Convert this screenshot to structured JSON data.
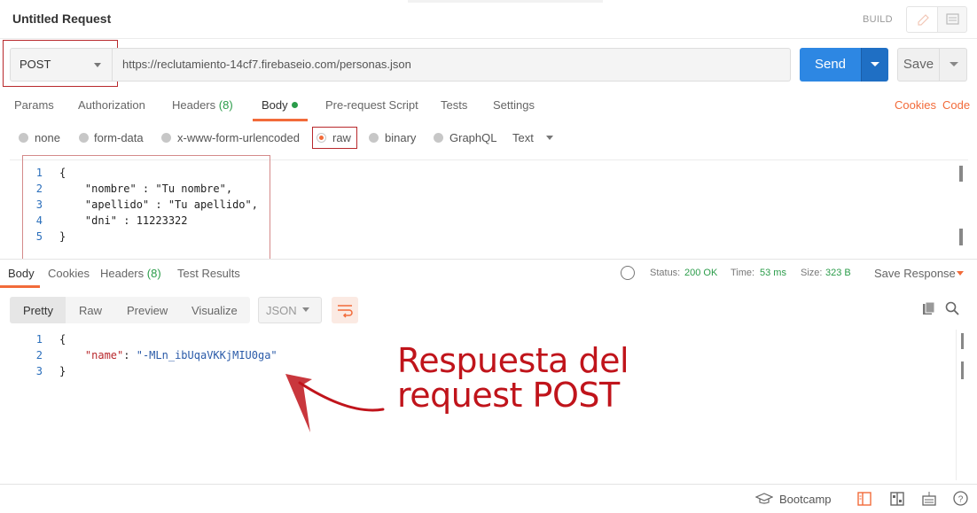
{
  "header": {
    "title": "Untitled Request",
    "build_label": "BUILD"
  },
  "request": {
    "method": "POST",
    "url": "https://reclutamiento-14cf7.firebaseio.com/personas.json",
    "send_label": "Send",
    "save_label": "Save"
  },
  "request_tabs": {
    "params": "Params",
    "authorization": "Authorization",
    "headers": "Headers",
    "headers_count": "(8)",
    "body": "Body",
    "prescript": "Pre-request Script",
    "tests": "Tests",
    "settings": "Settings",
    "cookies": "Cookies",
    "code": "Code"
  },
  "body_types": {
    "none": "none",
    "form_data": "form-data",
    "urlencoded": "x-www-form-urlencoded",
    "raw": "raw",
    "binary": "binary",
    "graphql": "GraphQL",
    "format": "Text"
  },
  "request_body": {
    "lines": [
      {
        "n": "1",
        "text": "{"
      },
      {
        "n": "2",
        "text": "    \"nombre\" : \"Tu nombre\","
      },
      {
        "n": "3",
        "text": "    \"apellido\" : \"Tu apellido\","
      },
      {
        "n": "4",
        "text": "    \"dni\" : 11223322"
      },
      {
        "n": "5",
        "text": "}"
      }
    ]
  },
  "response_tabs": {
    "body": "Body",
    "cookies": "Cookies",
    "headers": "Headers",
    "headers_count": "(8)",
    "test_results": "Test Results"
  },
  "response_meta": {
    "status_label": "Status:",
    "status_value": "200 OK",
    "time_label": "Time:",
    "time_value": "53 ms",
    "size_label": "Size:",
    "size_value": "323 B",
    "save_response": "Save Response"
  },
  "view_modes": {
    "pretty": "Pretty",
    "raw": "Raw",
    "preview": "Preview",
    "visualize": "Visualize",
    "format": "JSON"
  },
  "response_body": {
    "line1": "{",
    "key": "\"name\"",
    "sep": ": ",
    "value": "\"-MLn_ibUqaVKKjMIU0ga\"",
    "line3": "}"
  },
  "annotation": {
    "line1": "Respuesta del",
    "line2": "request POST"
  },
  "footer": {
    "bootcamp": "Bootcamp"
  },
  "colors": {
    "accent": "#f26b3a",
    "send": "#2d87e3",
    "success": "#2b9c4a",
    "annotation": "#c0141b"
  }
}
